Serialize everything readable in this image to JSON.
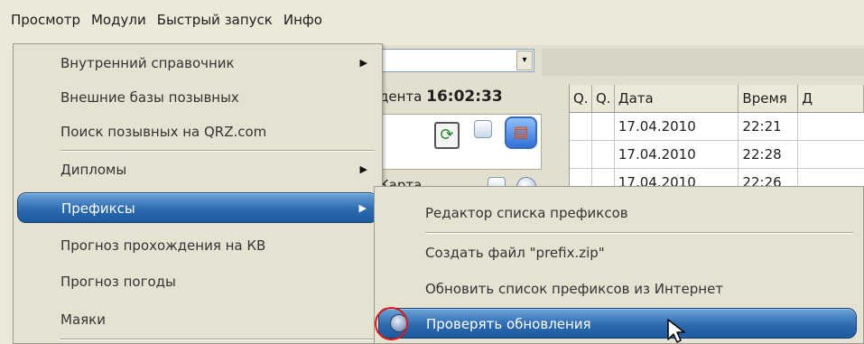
{
  "menubar": {
    "items": [
      "Просмотр",
      "Модули",
      "Быстрый запуск",
      "Инфо"
    ]
  },
  "background": {
    "combo_arrow": "▾",
    "time_prefix": "дента",
    "time_value": "16:02:33",
    "map_label": "Карта",
    "grid": {
      "headers": [
        "Q.",
        "Q.",
        "Дата",
        "Время",
        "Д"
      ],
      "rows": [
        [
          "",
          "",
          "17.04.2010",
          "22:21",
          ""
        ],
        [
          "",
          "",
          "17.04.2010",
          "22:28",
          ""
        ],
        [
          "",
          "",
          "17.04.2010",
          "22:26",
          ""
        ]
      ]
    }
  },
  "menu": {
    "items": [
      {
        "label": "Внутренний справочник",
        "arrow": "▶"
      },
      {
        "label": "Внешние базы позывных"
      },
      {
        "label": "Поиск позывных на QRZ.com"
      },
      {
        "label": "Дипломы",
        "arrow": "▶"
      },
      {
        "label": "Префиксы",
        "arrow": "▶"
      },
      {
        "label": "Прогноз прохождения на КВ"
      },
      {
        "label": "Прогноз погоды"
      },
      {
        "label": "Маяки"
      }
    ]
  },
  "submenu": {
    "items": [
      {
        "label": "Редактор списка префиксов"
      },
      {
        "label": "Создать файл \"prefix.zip\""
      },
      {
        "label": "Обновить список префиксов из Интернет"
      },
      {
        "label": "Проверять обновления"
      }
    ]
  },
  "colors": {
    "highlight": "#2d6bb0",
    "annotation_circle": "#e01818"
  }
}
